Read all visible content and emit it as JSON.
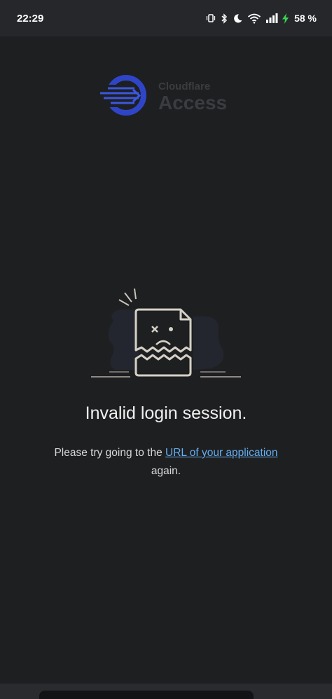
{
  "status_bar": {
    "time": "22:29",
    "battery": "58 %",
    "icons": [
      "vibrate-icon",
      "bluetooth-icon",
      "do-not-disturb-moon-icon",
      "wifi-icon",
      "signal-icon",
      "charging-bolt-icon"
    ]
  },
  "logo": {
    "brand": "Cloudflare",
    "product": "Access"
  },
  "error": {
    "title": "Invalid login session.",
    "message_before": "Please try going to the ",
    "link_text": "URL of your application",
    "message_after": "again."
  },
  "colors": {
    "background": "#1e1f21",
    "status_bar": "#26272b",
    "link": "#64aef0",
    "logo_blue": "#2f45c8",
    "illustration_line": "#d6d1c6"
  }
}
